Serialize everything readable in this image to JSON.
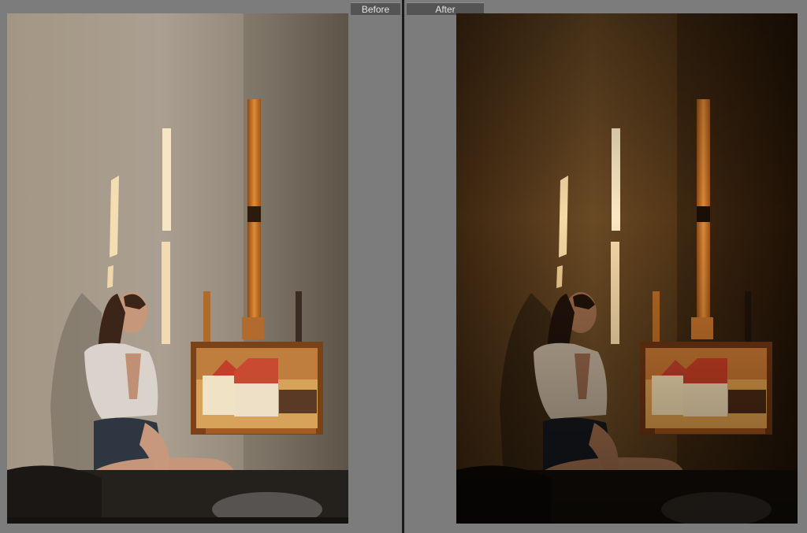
{
  "view": {
    "before_label": "Before",
    "after_label": "After"
  },
  "colors": {
    "workspace_bg": "#7c7c7c",
    "divider": "#1b1b1b",
    "label_bg": "#545454",
    "label_text": "#e4e4e4",
    "before_wall": "#a5998b",
    "after_wall": "#5e3f1c",
    "window_light": "#f3d39c",
    "painting_roof": "#c2402a"
  },
  "icons": {
    "before_photo": "photo-image",
    "after_photo": "photo-image"
  }
}
